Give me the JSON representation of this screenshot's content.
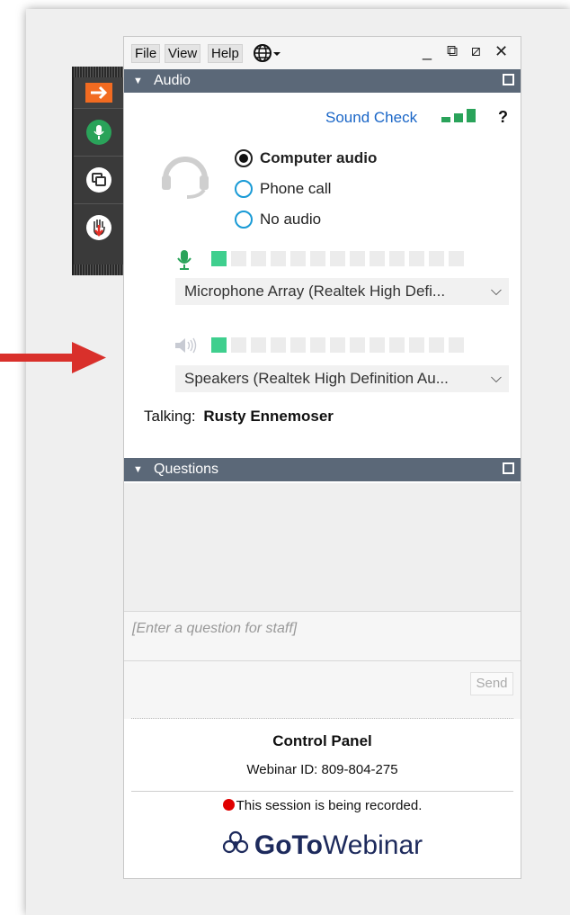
{
  "menu": {
    "file": "File",
    "view": "View",
    "help": "Help"
  },
  "window_controls": {
    "minimize": "_",
    "restore": "⧉",
    "popout": "⧄",
    "close": "✕"
  },
  "audio": {
    "header": "Audio",
    "sound_check": "Sound Check",
    "help_mark": "?",
    "options": [
      {
        "label": "Computer audio",
        "selected": true
      },
      {
        "label": "Phone call",
        "selected": false
      },
      {
        "label": "No audio",
        "selected": false
      }
    ],
    "mic_level_fraction": 0.08,
    "speaker_level_fraction": 0.08,
    "microphone_device": "Microphone Array (Realtek High Defi...",
    "speaker_device": "Speakers (Realtek High Definition Au...",
    "talking_label": "Talking:",
    "talking_name": "Rusty Ennemoser"
  },
  "questions": {
    "header": "Questions",
    "placeholder": "[Enter a question for staff]",
    "send_label": "Send"
  },
  "footer": {
    "title": "Control Panel",
    "webinar_id": "Webinar ID: 809-804-275",
    "recording_notice": "This session is being recorded.",
    "logo_bold": "GoTo",
    "logo_light": "Webinar"
  },
  "colors": {
    "header_bg": "#5b6878",
    "accent_blue": "#1a66c7",
    "meter_green": "#3fcf8e",
    "arrow_red": "#d9302b",
    "toolbar_orange": "#f26b21",
    "mic_green": "#2aa35a"
  },
  "icons": [
    "arrow-right-icon",
    "microphone-icon",
    "screen-share-icon",
    "raise-hand-icon",
    "headset-icon",
    "globe-icon",
    "speaker-icon",
    "signal-bars-icon",
    "record-dot-icon",
    "gotowebinar-logo"
  ]
}
